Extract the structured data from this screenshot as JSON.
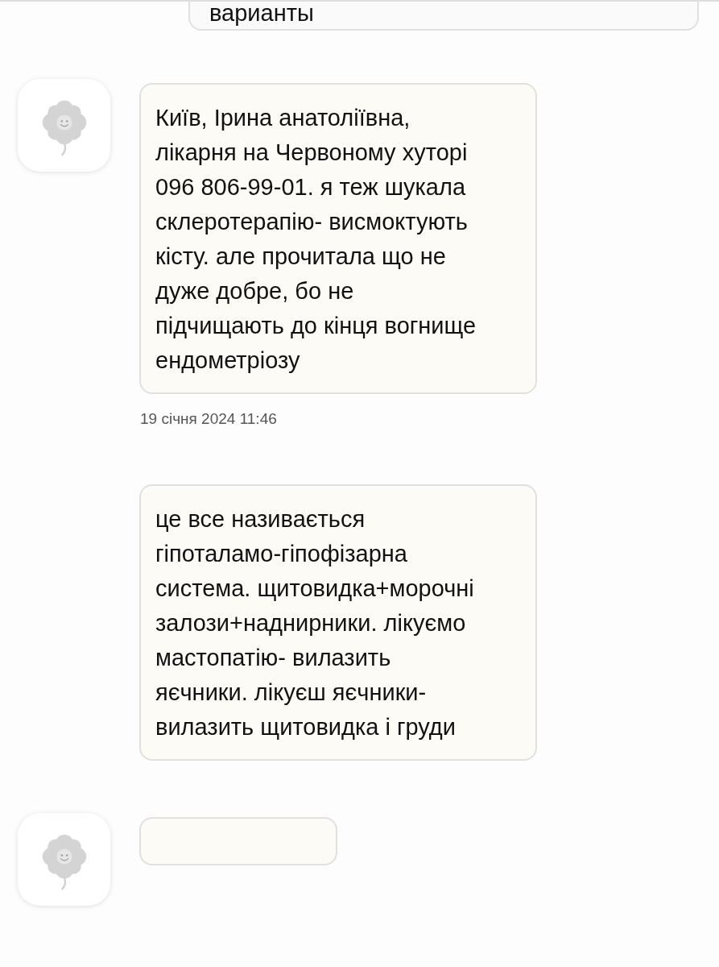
{
  "previous_message": {
    "text": "варианты"
  },
  "messages": [
    {
      "avatar": true,
      "text": "Київ, Ірина анатоліївна, лікарня на Червоному хуторі 096 806-99-01. я теж шукала склеротерапію- висмоктують кісту. але прочитала що не дуже добре, бо не підчищають до кінця вогнище ендометріозу",
      "timestamp": "19 січня 2024 11:46"
    },
    {
      "avatar": false,
      "text": "це все називається гіпоталамо-гіпофізарна система. щитовидка+морочні залози+наднирники. лікуємо мастопатію- вилазить яєчники. лікуєш яєчники-вилазить щитовидка і груди"
    },
    {
      "avatar": true
    }
  ]
}
